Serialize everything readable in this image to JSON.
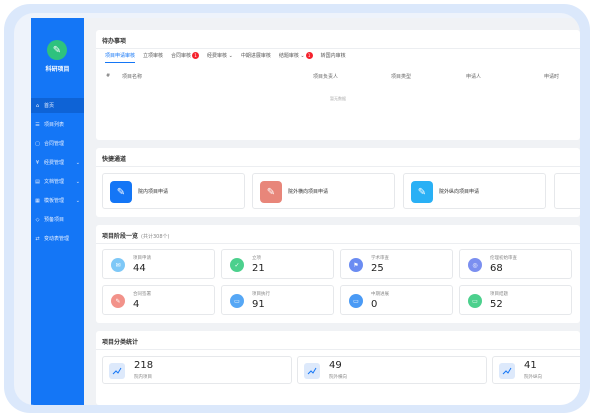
{
  "sidebar": {
    "logo_icon": "✎",
    "app_title": "科研项目",
    "items": [
      {
        "label": "首页",
        "icon": "⌂",
        "arrow": ""
      },
      {
        "label": "项目列表",
        "icon": "☰",
        "arrow": ""
      },
      {
        "label": "合同管理",
        "icon": "▢",
        "arrow": ""
      },
      {
        "label": "经费管理",
        "icon": "¥",
        "arrow": "⌄"
      },
      {
        "label": "文档管理",
        "icon": "▤",
        "arrow": "⌄"
      },
      {
        "label": "模板管理",
        "icon": "▦",
        "arrow": "⌄"
      },
      {
        "label": "预备项目",
        "icon": "◇",
        "arrow": ""
      },
      {
        "label": "变动表管理",
        "icon": "⇄",
        "arrow": ""
      }
    ]
  },
  "todo": {
    "title": "待办事项",
    "tabs": [
      {
        "label": "项目申请审核",
        "badge": ""
      },
      {
        "label": "立项审核",
        "badge": ""
      },
      {
        "label": "合同审核",
        "badge": "1"
      },
      {
        "label": "经费审核 ⌄",
        "badge": ""
      },
      {
        "label": "中期进展审核",
        "badge": ""
      },
      {
        "label": "结题审核 ⌄",
        "badge": "1"
      },
      {
        "label": "转国内审核",
        "badge": ""
      }
    ],
    "columns": [
      "#",
      "项目名称",
      "项目负责人",
      "项目类型",
      "申请人",
      "申请时"
    ],
    "empty_text": "暂无数据"
  },
  "quick": {
    "title": "快捷通道",
    "items": [
      {
        "label": "院内项目申请",
        "icon": "✎",
        "color": "#1476f6"
      },
      {
        "label": "院外横向项目申请",
        "icon": "✎",
        "color": "#e8867a"
      },
      {
        "label": "院外纵向项目申请",
        "icon": "✎",
        "color": "#29b0f5"
      }
    ]
  },
  "stages": {
    "title": "项目阶段一览",
    "subtitle": "(共计308个)",
    "items": [
      {
        "label": "项目申请",
        "value": "44",
        "color": "#7ec8f7",
        "icon": "✉"
      },
      {
        "label": "立项",
        "value": "21",
        "color": "#4cd08d",
        "icon": "✓"
      },
      {
        "label": "学术审查",
        "value": "25",
        "color": "#6b8cf2",
        "icon": "⚑"
      },
      {
        "label": "伦理初始审查",
        "value": "68",
        "color": "#7b8ff0",
        "icon": "◎"
      },
      {
        "label": "合同签署",
        "value": "4",
        "color": "#f2928a",
        "icon": "✎"
      },
      {
        "label": "项目执行",
        "value": "91",
        "color": "#56a7f5",
        "icon": "▭"
      },
      {
        "label": "中期进展",
        "value": "0",
        "color": "#4a9af5",
        "icon": "▭"
      },
      {
        "label": "项目结题",
        "value": "52",
        "color": "#4cd08d",
        "icon": "▭"
      }
    ]
  },
  "category": {
    "title": "项目分类统计",
    "items": [
      {
        "value": "218",
        "label": "院内项目"
      },
      {
        "value": "49",
        "label": "院外横向"
      },
      {
        "value": "41",
        "label": "院外纵向"
      }
    ]
  }
}
